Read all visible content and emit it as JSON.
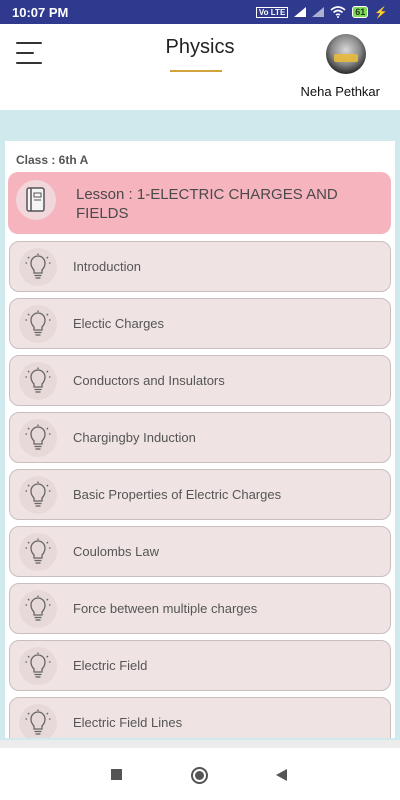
{
  "status_bar": {
    "time": "10:07 PM",
    "sim_badge": "Vo LTE",
    "battery_level": "61",
    "icons": [
      "sim-icon",
      "signal-icon",
      "signal-icon",
      "wifi-icon",
      "battery-icon",
      "charging-icon"
    ]
  },
  "header": {
    "title": "Physics",
    "user_name": "Neha Pethkar",
    "accent_color": "#d4a33b"
  },
  "content": {
    "class_label": "Class : 6th A",
    "lesson_title": "Lesson : 1-ELECTRIC CHARGES AND FIELDS",
    "lesson_color": "#f6b4bf",
    "topics": [
      {
        "label": "Introduction"
      },
      {
        "label": "Electic Charges"
      },
      {
        "label": "Conductors and Insulators"
      },
      {
        "label": "Chargingby Induction"
      },
      {
        "label": "Basic Properties of Electric Charges"
      },
      {
        "label": "Coulombs Law"
      },
      {
        "label": "Force between multiple charges"
      },
      {
        "label": "Electric Field"
      },
      {
        "label": "Electric Field Lines"
      }
    ]
  },
  "nav": {
    "icons": [
      "recent-apps-icon",
      "home-icon",
      "back-icon"
    ]
  }
}
